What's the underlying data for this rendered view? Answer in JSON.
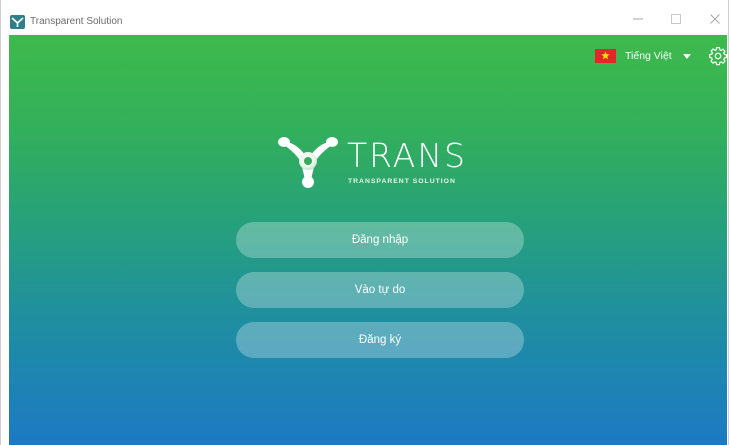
{
  "window": {
    "title": "Transparent Solution",
    "controls": {
      "minimize_icon": "minimize-icon",
      "maximize_icon": "maximize-icon",
      "close_icon": "close-icon"
    }
  },
  "header": {
    "language": {
      "flag_icon": "vietnam-flag-icon",
      "label": "Tiếng Việt",
      "dropdown_icon": "caret-down-icon"
    },
    "settings_icon": "gear-icon"
  },
  "brand": {
    "name": "TRANS",
    "tagline": "TRANSPARENT SOLUTION"
  },
  "actions": {
    "login_label": "Đăng nhập",
    "free_entry_label": "Vào tự do",
    "register_label": "Đăng ký"
  },
  "colors": {
    "gradient_top": "#3eba4c",
    "gradient_bottom": "#1d79c4",
    "button_fill": "rgba(255,255,255,0.28)",
    "text": "#ffffff"
  }
}
